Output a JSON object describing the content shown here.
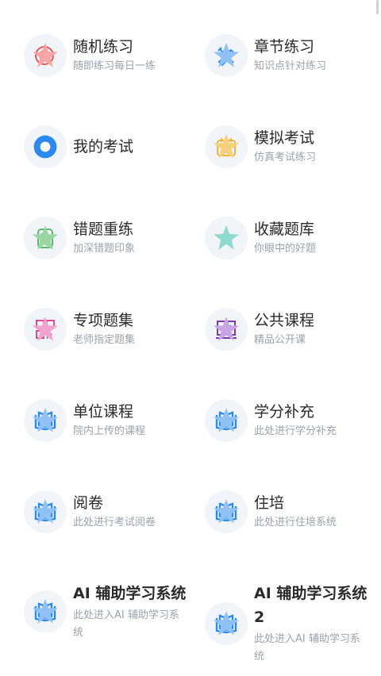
{
  "colors": {
    "blue": "#2b89f0",
    "red": "#e0575c",
    "green": "#5bb96b",
    "yellow": "#f0b43c",
    "teal": "#29b3a7",
    "pink": "#d84c9c",
    "purple": "#7b3bb4",
    "star_blue": "#8fc1f4",
    "star_pink": "#f7a6a6",
    "star_green": "#9ad6a2",
    "star_yellow": "#f6d07a"
  },
  "items": [
    {
      "title": "随机练习",
      "subtitle": "随即练习每日一练",
      "icon": "random-practice-icon"
    },
    {
      "title": "章节练习",
      "subtitle": "知识点针对练习",
      "icon": "chapter-practice-icon"
    },
    {
      "title": "我的考试",
      "subtitle": "",
      "icon": "my-exam-icon"
    },
    {
      "title": "模拟考试",
      "subtitle": "仿真考试练习",
      "icon": "mock-exam-icon"
    },
    {
      "title": "错题重练",
      "subtitle": "加深错题印象",
      "icon": "wrong-question-icon"
    },
    {
      "title": "收藏题库",
      "subtitle": "你眼中的好题",
      "icon": "favorites-star-icon"
    },
    {
      "title": "专项题集",
      "subtitle": "老师指定题集",
      "icon": "special-set-icon"
    },
    {
      "title": "公共课程",
      "subtitle": "精品公开课",
      "icon": "public-course-icon"
    },
    {
      "title": "单位课程",
      "subtitle": "院内上传的课程",
      "icon": "book-icon"
    },
    {
      "title": "学分补充",
      "subtitle": "此处进行学分补充",
      "icon": "book-icon"
    },
    {
      "title": "阅卷",
      "subtitle": "此处进行考试阅卷",
      "icon": "book-icon"
    },
    {
      "title": "住培",
      "subtitle": "此处进行住培系统",
      "icon": "book-icon"
    },
    {
      "title": "AI 辅助学习系统",
      "subtitle": "此处进入AI 辅助学习系统",
      "icon": "book-icon"
    },
    {
      "title": "AI 辅助学习系统2",
      "subtitle": "此处进入AI 辅助学习系统",
      "icon": "book-icon"
    }
  ]
}
